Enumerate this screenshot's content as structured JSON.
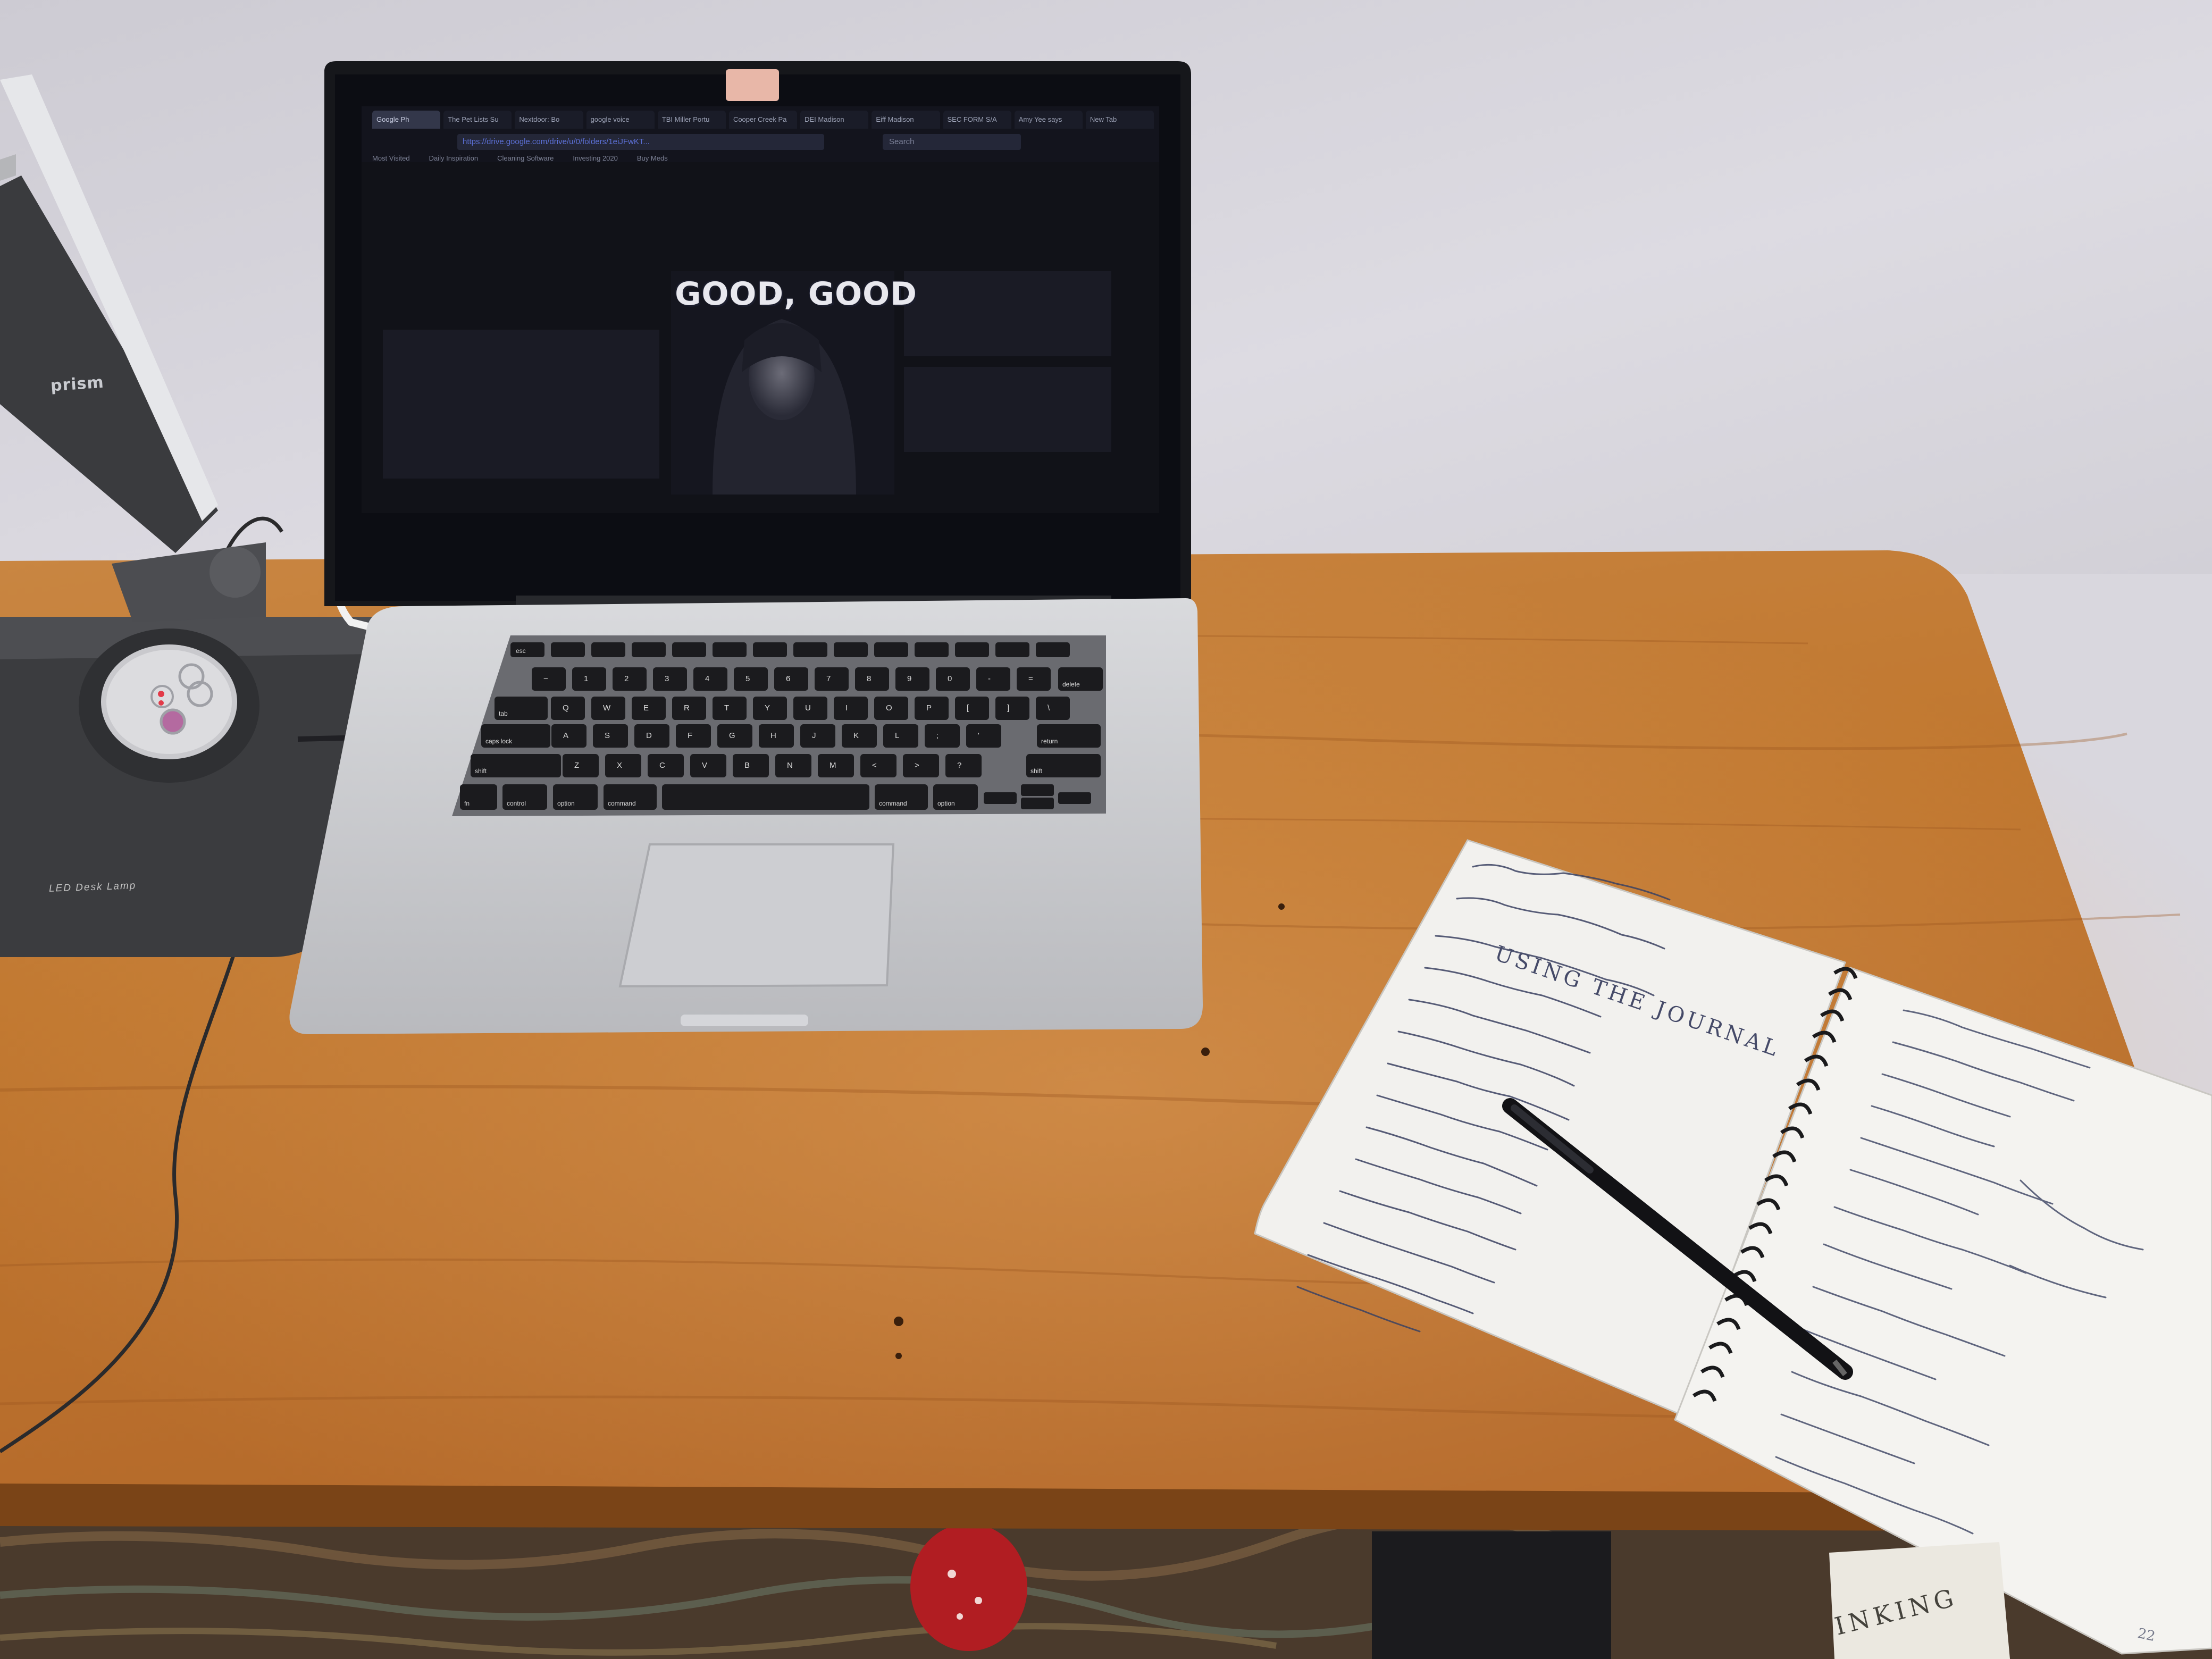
{
  "scene": {
    "description_elements": [
      "desk-lamp",
      "laptop",
      "notebook",
      "pen",
      "wooden-desk",
      "rug"
    ],
    "colors": {
      "wall": "#d9d7de",
      "desk": "#c07a36",
      "desk_dark": "#8f5119",
      "laptop_body": "#cbccd0",
      "screen": "#0d0e14",
      "paper": "#f3f2ef",
      "ink": "#38405e",
      "lamp": "#3e3f42"
    }
  },
  "lamp": {
    "brand": "prism",
    "model_label": "LED Desk Lamp"
  },
  "browser": {
    "tabs": [
      "Google Ph",
      "The Pet Lists Su",
      "Nextdoor: Bo",
      "google voice",
      "TBI Miller Portu",
      "Cooper Creek Pa",
      "DEI Madison",
      "Eiff Madison",
      "SEC FORM S/A",
      "Amy Yee says",
      "New Tab"
    ],
    "url": "https://drive.google.com/drive/u/0/folders/1eiJFwKT...",
    "search_placeholder": "Search",
    "bookmarks": [
      "Most Visited",
      "Daily Inspiration",
      "Cleaning Software",
      "Investing 2020",
      "Buy Meds"
    ]
  },
  "screen": {
    "meme_caption": "GOOD, GOOD"
  },
  "keyboard": {
    "special_keys": {
      "esc": "esc",
      "delete": "delete",
      "tab": "tab",
      "caps": "caps lock",
      "return": "return",
      "shift_left": "shift",
      "shift_right": "shift",
      "fn": "fn",
      "control": "control",
      "option_left": "option",
      "command_left": "command",
      "command_right": "command",
      "option_right": "option"
    },
    "rows": [
      [
        "~",
        "1",
        "2",
        "3",
        "4",
        "5",
        "6",
        "7",
        "8",
        "9",
        "0",
        "-",
        "="
      ],
      [
        "Q",
        "W",
        "E",
        "R",
        "T",
        "Y",
        "U",
        "I",
        "O",
        "P",
        "[",
        "]",
        "\\"
      ],
      [
        "A",
        "S",
        "D",
        "F",
        "G",
        "H",
        "J",
        "K",
        "L",
        ";",
        "'"
      ],
      [
        "Z",
        "X",
        "C",
        "V",
        "B",
        "N",
        "M",
        "<",
        ">",
        "?"
      ]
    ]
  },
  "notebook": {
    "left_page_title": "USING THE JOURNAL",
    "page_number": "22",
    "book_title": "INKING"
  }
}
